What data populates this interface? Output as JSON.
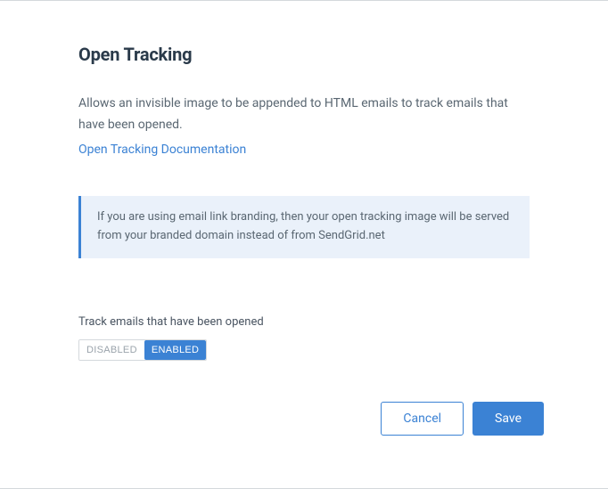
{
  "title": "Open Tracking",
  "description": "Allows an invisible image to be appended to HTML emails to track emails that have been opened.",
  "doc_link_text": "Open Tracking Documentation",
  "info_box": "If you are using email link branding, then your open tracking image will be served from your branded domain instead of from SendGrid.net",
  "toggle": {
    "label": "Track emails that have been opened",
    "disabled_text": "DISABLED",
    "enabled_text": "ENABLED"
  },
  "footer": {
    "cancel": "Cancel",
    "save": "Save"
  }
}
